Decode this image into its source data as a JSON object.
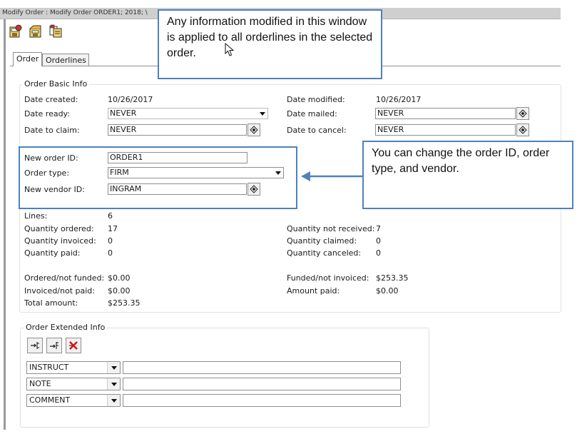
{
  "window": {
    "title": "Modify Order : Modify Order  ORDER1; 2018; \\"
  },
  "toolbar": {
    "icons": [
      "save-order-icon",
      "save-as-icon",
      "copy-order-icon"
    ]
  },
  "tabs": [
    {
      "label": "Order"
    },
    {
      "label": "Orderlines"
    }
  ],
  "basic_info": {
    "title": "Order Basic Info",
    "date_created": {
      "label": "Date created:",
      "value": "10/26/2017"
    },
    "date_modified": {
      "label": "Date modified:",
      "value": "10/26/2017"
    },
    "date_ready": {
      "label": "Date ready:",
      "value": "NEVER"
    },
    "date_mailed": {
      "label": "Date mailed:",
      "value": "NEVER"
    },
    "date_to_claim": {
      "label": "Date to claim:",
      "value": "NEVER"
    },
    "date_to_cancel": {
      "label": "Date to cancel:",
      "value": "NEVER"
    },
    "new_order_id": {
      "label": "New order ID:",
      "value": "ORDER1"
    },
    "order_type": {
      "label": "Order type:",
      "value": "FIRM"
    },
    "new_vendor_id": {
      "label": "New vendor ID:",
      "value": "INGRAM"
    },
    "lines": {
      "label": "Lines:",
      "value": "6"
    },
    "qty_ordered": {
      "label": "Quantity ordered:",
      "value": "17"
    },
    "qty_invoiced": {
      "label": "Quantity invoiced:",
      "value": "0"
    },
    "qty_paid": {
      "label": "Quantity paid:",
      "value": "0"
    },
    "qty_not_received": {
      "label": "Quantity not received:",
      "value": "7"
    },
    "qty_claimed": {
      "label": "Quantity claimed:",
      "value": "0"
    },
    "qty_canceled": {
      "label": "Quantity canceled:",
      "value": "0"
    },
    "ordered_not_funded": {
      "label": "Ordered/not funded:",
      "value": "$0.00"
    },
    "invoiced_not_paid": {
      "label": "Invoiced/not paid:",
      "value": "$0.00"
    },
    "total_amount": {
      "label": "Total amount:",
      "value": "$253.35"
    },
    "funded_not_invoiced": {
      "label": "Funded/not invoiced:",
      "value": "$253.35"
    },
    "amount_paid": {
      "label": "Amount paid:",
      "value": "$0.00"
    }
  },
  "extended_info": {
    "title": "Order Extended Info",
    "buttons": [
      "add-field-icon",
      "insert-field-icon",
      "delete-field-icon"
    ],
    "rows": [
      {
        "type": "INSTRUCT",
        "value": ""
      },
      {
        "type": "NOTE",
        "value": ""
      },
      {
        "type": "COMMENT",
        "value": ""
      }
    ]
  },
  "callouts": {
    "top": "Any information modified in this window is applied to all orderlines in the selected order.",
    "right": "You can change the order ID, order type, and vendor."
  },
  "colors": {
    "callout_border": "#4f81bd",
    "arrow": "#4f81bd"
  }
}
